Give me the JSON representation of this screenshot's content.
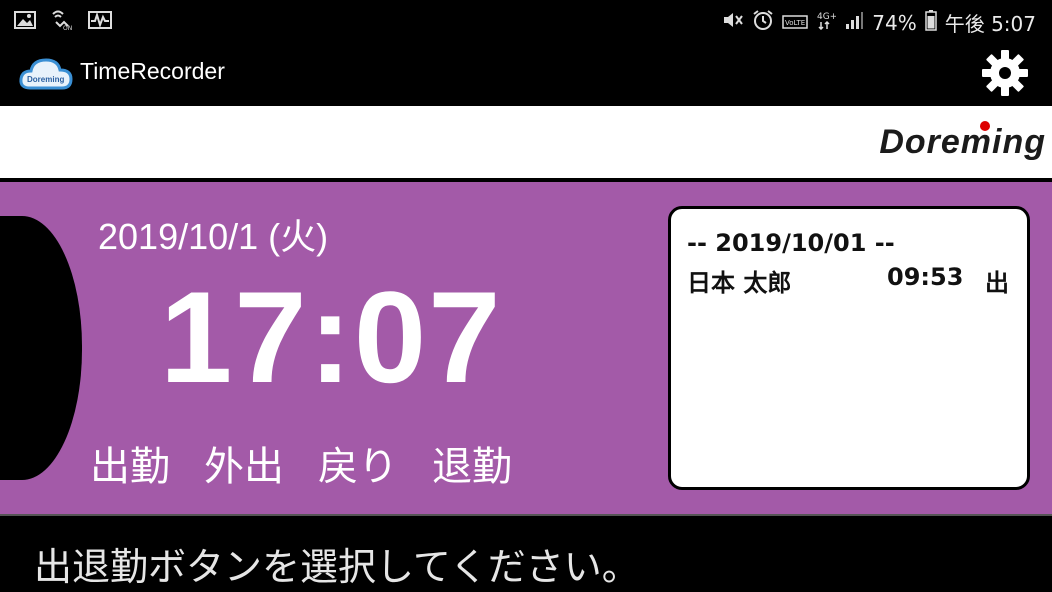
{
  "status_bar": {
    "icons_left": [
      "image-icon",
      "wifi-calling-icon",
      "activity-icon"
    ],
    "icons_right": [
      "mute-icon",
      "alarm-icon",
      "volte-icon",
      "4g-icon",
      "signal-icon",
      "battery-icon"
    ],
    "battery": "74%",
    "time": "午後 5:07"
  },
  "app": {
    "title": "TimeRecorder",
    "logo_label": "Doreming"
  },
  "brand": {
    "name": "Doreming"
  },
  "main": {
    "date": "2019/10/1 (火)",
    "clock": "17:07",
    "buttons": [
      "出勤",
      "外出",
      "戻り",
      "退勤"
    ]
  },
  "log": {
    "date_header": "-- 2019/10/01 --",
    "entries": [
      {
        "name": "日本 太郎",
        "time": "09:53",
        "type": "出"
      }
    ]
  },
  "footer": {
    "message": "出退勤ボタンを選択してください。"
  },
  "colors": {
    "panel": "#a35aa8",
    "bar": "#000000",
    "brand_dot": "#dd0000"
  }
}
